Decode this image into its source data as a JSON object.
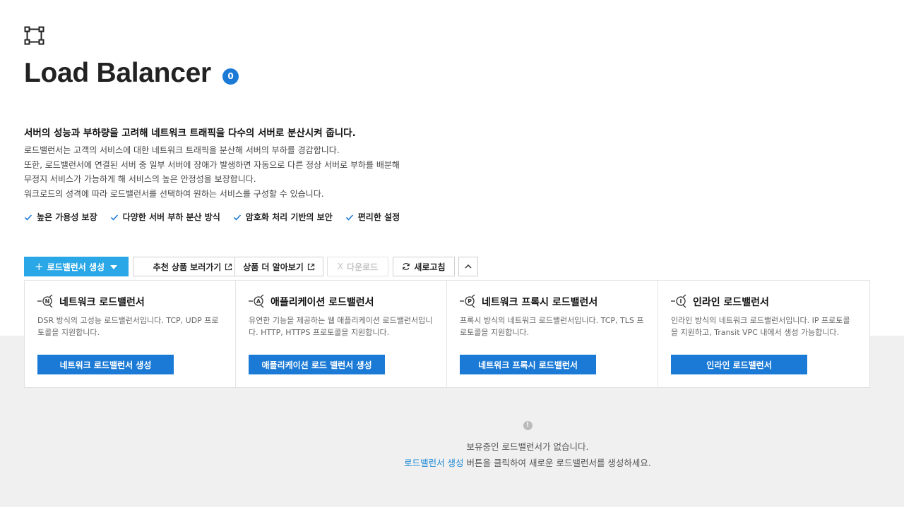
{
  "header": {
    "title": "Load Balancer",
    "count": "0"
  },
  "intro": {
    "headline": "서버의 성능과 부하량을 고려해 네트워크 트래픽을 다수의 서버로 분산시켜 줍니다.",
    "lines": [
      "로드밸런서는 고객의 서비스에 대한 네트워크 트래픽을 분산해 서버의 부하를 경감합니다.",
      "또한, 로드밸런서에 연결된 서버 중 일부 서버에 장애가 발생하면 자동으로 다른 정상 서버로 부하를 배분해",
      "무정지 서비스가 가능하게 해 서비스의 높은 안정성을 보장합니다.",
      "워크로드의 성격에 따라 로드밸런서를 선택하여 원하는 서비스를 구성할 수 있습니다."
    ],
    "features": [
      "높은 가용성 보장",
      "다양한 서버 부하 분산 방식",
      "암호화 처리 기반의 보안",
      "편리한 설정"
    ]
  },
  "toolbar": {
    "create_label": "로드밸런서 생성",
    "recommend_label": "추천 상품 보러가기",
    "learn_more_label": "상품 더 알아보기",
    "download_label": "다운로드",
    "refresh_label": "새로고침"
  },
  "cards": [
    {
      "title": "네트워크 로드밸런서",
      "icon_letter": "N",
      "desc": "DSR 방식의 고성능 로드밸런서입니다. TCP, UDP 프로토콜을 지원합니다.",
      "button": "네트워크 로드밸런서 생성"
    },
    {
      "title": "애플리케이션 로드밸런서",
      "icon_letter": "A",
      "desc": "유연한 기능을 제공하는 웹 애플리케이션 로드밸런서입니다. HTTP, HTTPS 프로토콜을 지원합니다.",
      "button": "애플리케이션 로드 밸런서 생성"
    },
    {
      "title": "네트워크 프록시 로드밸런서",
      "icon_letter": "P",
      "desc": "프록시 방식의 네트워크 로드밸런서입니다. TCP, TLS 프로토콜을 지원합니다.",
      "button": "네트워크 프록시 로드밸런서"
    },
    {
      "title": "인라인 로드밸런서",
      "icon_letter": "I",
      "desc": "인라인 방식의 네트워크 로드밸런서입니다. IP 프로토콜을 지원하고, Transit VPC 내에서 생성 가능합니다.",
      "button": "인라인 로드밸런서"
    }
  ],
  "empty_state": {
    "icon": "!",
    "message": "보유중인 로드밸런서가 없습니다.",
    "link": "로드밸런서 생성",
    "suffix": " 버튼을 클릭하여 새로운 로드밸런서를 생성하세요."
  },
  "colors": {
    "primary": "#1b7ad6",
    "create_button": "#2aa7e6",
    "link": "#1e8ad6",
    "check": "#1b7ad6"
  }
}
